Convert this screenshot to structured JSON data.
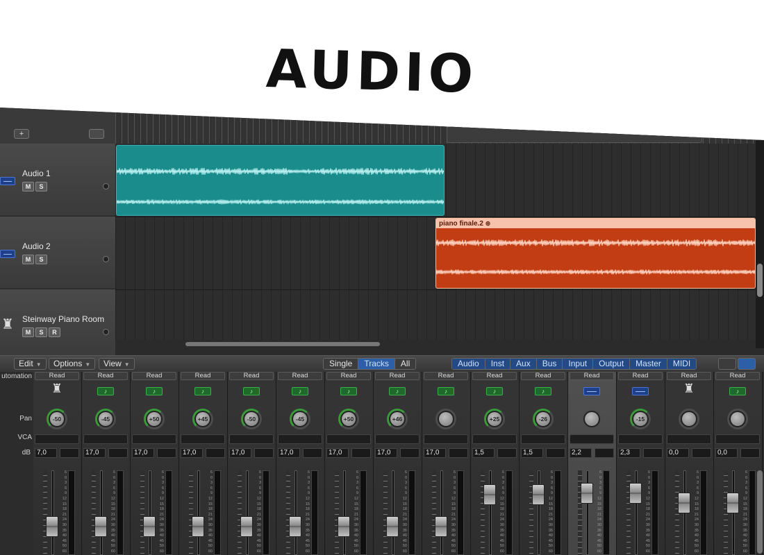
{
  "title": "AUDIO",
  "tracks": [
    {
      "name": "Audio 1",
      "type": "audio",
      "buttons": [
        "M",
        "S"
      ]
    },
    {
      "name": "Audio 2",
      "type": "audio",
      "buttons": [
        "M",
        "S"
      ]
    },
    {
      "name": "Steinway Piano Room",
      "type": "instrument",
      "buttons": [
        "M",
        "S",
        "R"
      ]
    }
  ],
  "regions": {
    "teal_color": "#1a8c8c",
    "orange_color": "#c23d14",
    "orange_label": "piano finale.2"
  },
  "mixer_toolbar": {
    "edit": "Edit",
    "options": "Options",
    "view": "View",
    "modes": [
      "Single",
      "Tracks",
      "All"
    ],
    "active_mode": "Tracks",
    "filters": [
      "Audio",
      "Inst",
      "Aux",
      "Bus",
      "Input",
      "Output",
      "Master",
      "MIDI"
    ]
  },
  "row_labels": {
    "automation": "utomation",
    "pan": "Pan",
    "vca": "VCA",
    "db": "dB"
  },
  "strips": [
    {
      "read": "Read",
      "icon": "piano",
      "pan": "-50",
      "db": "7,0",
      "fader": 0.28
    },
    {
      "read": "Read",
      "icon": "midi",
      "pan": "-45",
      "db": "17,0",
      "fader": 0.28
    },
    {
      "read": "Read",
      "icon": "midi",
      "pan": "+50",
      "db": "17,0",
      "fader": 0.28
    },
    {
      "read": "Read",
      "icon": "midi",
      "pan": "+45",
      "db": "17,0",
      "fader": 0.28
    },
    {
      "read": "Read",
      "icon": "midi",
      "pan": "-50",
      "db": "17,0",
      "fader": 0.28
    },
    {
      "read": "Read",
      "icon": "midi",
      "pan": "-45",
      "db": "17,0",
      "fader": 0.28
    },
    {
      "read": "Read",
      "icon": "midi",
      "pan": "+50",
      "db": "17,0",
      "fader": 0.28
    },
    {
      "read": "Read",
      "icon": "midi",
      "pan": "+46",
      "db": "17,0",
      "fader": 0.28
    },
    {
      "read": "Read",
      "icon": "midi",
      "pan": "",
      "db": "17,0",
      "fader": 0.28
    },
    {
      "read": "Read",
      "icon": "midi",
      "pan": "+25",
      "db": "1,5",
      "fader": 0.78
    },
    {
      "read": "Read",
      "icon": "midi",
      "pan": "-26",
      "db": "1,5",
      "fader": 0.78
    },
    {
      "read": "Read",
      "icon": "audio",
      "pan": "",
      "db": "2,2",
      "fader": 0.8,
      "selected": true
    },
    {
      "read": "Read",
      "icon": "audio",
      "pan": "-15",
      "db": "2,3",
      "fader": 0.8
    },
    {
      "read": "Read",
      "icon": "piano",
      "pan": "",
      "db": "0,0",
      "fader": 0.65
    },
    {
      "read": "Read",
      "icon": "midi",
      "pan": "",
      "db": "0,0",
      "fader": 0.65
    }
  ]
}
